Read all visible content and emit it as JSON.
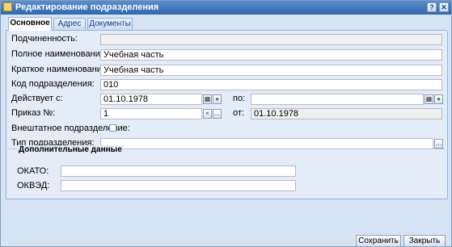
{
  "window": {
    "title": "Редактирование подразделения",
    "controls": {
      "help": "?",
      "close": "✕"
    }
  },
  "tabs": [
    {
      "label": "Основное"
    },
    {
      "label": "Адрес"
    },
    {
      "label": "Документы"
    }
  ],
  "form": {
    "subordination_label": "Подчиненность:",
    "subordination_value": "",
    "full_name_label": "Полное наименование:",
    "full_name_value": "Учебная часть",
    "short_name_label": "Краткое наименование:",
    "short_name_value": "Учебная часть",
    "code_label": "Код подразделения:",
    "code_value": "010",
    "valid_from_label": "Действует с:",
    "valid_from_value": "01.10.1978",
    "valid_to_label": "по:",
    "valid_to_value": "",
    "order_label": "Приказ №:",
    "order_value": "1",
    "order_from_label": "от:",
    "order_from_value": "01.10.1978",
    "freelance_label": "Внештатное подразделение:",
    "type_label": "Тип подразделения:",
    "type_value": "",
    "ellipsis": "...",
    "clear": "×"
  },
  "extra": {
    "legend": "Дополнительные данные",
    "okato_label": "ОКАТО:",
    "okato_value": "",
    "okved_label": "ОКВЭД:",
    "okved_value": ""
  },
  "footer": {
    "save_label": "Сохранить",
    "close_label": "Закрыть"
  }
}
